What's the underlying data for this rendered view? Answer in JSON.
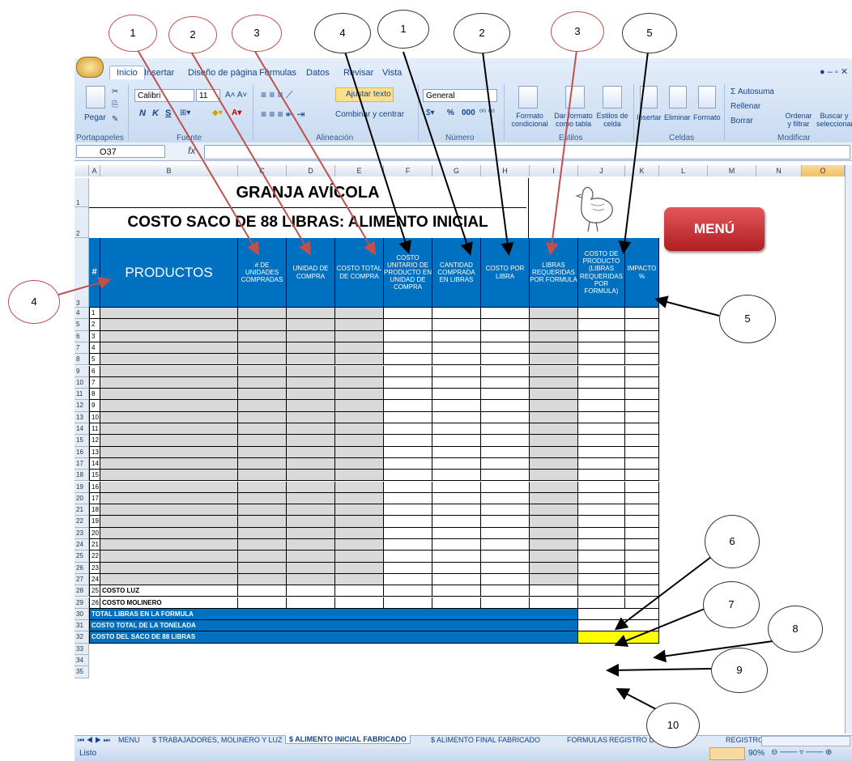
{
  "ribbon": {
    "tabs": [
      "Inicio",
      "Insertar",
      "Diseño de página",
      "Fórmulas",
      "Datos",
      "Revisar",
      "Vista"
    ],
    "groups": [
      "Portapapeles",
      "Fuente",
      "Alineación",
      "Número",
      "Estilos",
      "Celdas",
      "Modificar"
    ],
    "paste": "Pegar",
    "font_name": "Calibri",
    "font_size": "11",
    "bold": "N",
    "italic": "K",
    "underline": "S",
    "wrap_text": "Ajustar texto",
    "merge_center": "Combinar y centrar",
    "number_format": "General",
    "percent": "%",
    "thousands": "000",
    "cond_format": "Formato condicional",
    "format_table": "Dar formato como tabla",
    "cell_styles": "Estilos de celda",
    "insert": "Insertar",
    "delete": "Eliminar",
    "format": "Formato",
    "autosum": "Σ Autosuma",
    "fill": "Rellenar",
    "clear": "Borrar",
    "sort_filter": "Ordenar y filtrar",
    "find_select": "Buscar y seleccionar"
  },
  "formula_bar": {
    "name_box": "O37",
    "fx": "fx"
  },
  "columns": [
    "A",
    "B",
    "C",
    "D",
    "E",
    "F",
    "G",
    "H",
    "I",
    "J",
    "K",
    "L",
    "M",
    "N",
    "O"
  ],
  "sheet": {
    "title": "GRANJA AVÍCOLA",
    "subtitle": "COSTO SACO DE 88 LIBRAS: ALIMENTO INICIAL",
    "headers": {
      "num": "#",
      "productos": "PRODUCTOS",
      "c": "# DE UNIDADES COMPRADAS",
      "d": "UNIDAD DE COMPRA",
      "e": "COSTO TOTAL DE COMPRA",
      "f": "COSTO UNITARIO DE PRODUCTO EN UNIDAD DE COMPRA",
      "g": "CANTIDAD COMPRADA EN LIBRAS",
      "h": "COSTO POR LIBRA",
      "i": "LIBRAS REQUERIDAS POR FORMULA",
      "j": "COSTO DE PRODUCTO (LIBRAS REQUERIDAS POR FORMULA)",
      "k": "IMPACTO %"
    },
    "row_numbers": [
      "1",
      "2",
      "3",
      "4",
      "5",
      "6",
      "7",
      "8",
      "9",
      "10",
      "11",
      "12",
      "13",
      "14",
      "15",
      "16",
      "17",
      "18",
      "19",
      "20",
      "21",
      "22",
      "23",
      "24",
      "25",
      "26",
      "27",
      "28",
      "29",
      "30",
      "31",
      "32",
      "33",
      "34",
      "35"
    ],
    "item_numbers": [
      "1",
      "2",
      "3",
      "4",
      "5",
      "6",
      "7",
      "8",
      "9",
      "10",
      "11",
      "12",
      "13",
      "14",
      "15",
      "16",
      "17",
      "18",
      "19",
      "20",
      "21",
      "22",
      "23",
      "24",
      "25",
      "26"
    ],
    "costo_luz": "COSTO LUZ",
    "costo_molinero": "COSTO MOLINERO",
    "total_libras": "TOTAL LIBRAS EN LA FORMULA",
    "costo_tonelada": "COSTO TOTAL DE LA TONELADA",
    "costo_saco": "COSTO DEL SACO DE 88 LIBRAS",
    "menu_button": "MENÚ"
  },
  "callouts": [
    "1",
    "2",
    "3",
    "4",
    "1",
    "2",
    "3",
    "5",
    "4",
    "5",
    "6",
    "7",
    "8",
    "9",
    "10"
  ],
  "sheet_tabs": [
    "MENU",
    "$ TRABAJADORES, MOLINERO Y LUZ",
    "$ ALIMENTO INICIAL FABRICADO",
    "$ ALIMENTO FINAL FABRICADO",
    "FORMULAS",
    "REGISTRO D",
    "REGISTRO"
  ],
  "status": {
    "text": "Listo",
    "zoom": "90%"
  },
  "colors": {
    "header_blue": "#0070c0",
    "input_gray": "#d9d9d9",
    "result_yellow": "#ffff00",
    "menu_red": "#c0292b"
  }
}
